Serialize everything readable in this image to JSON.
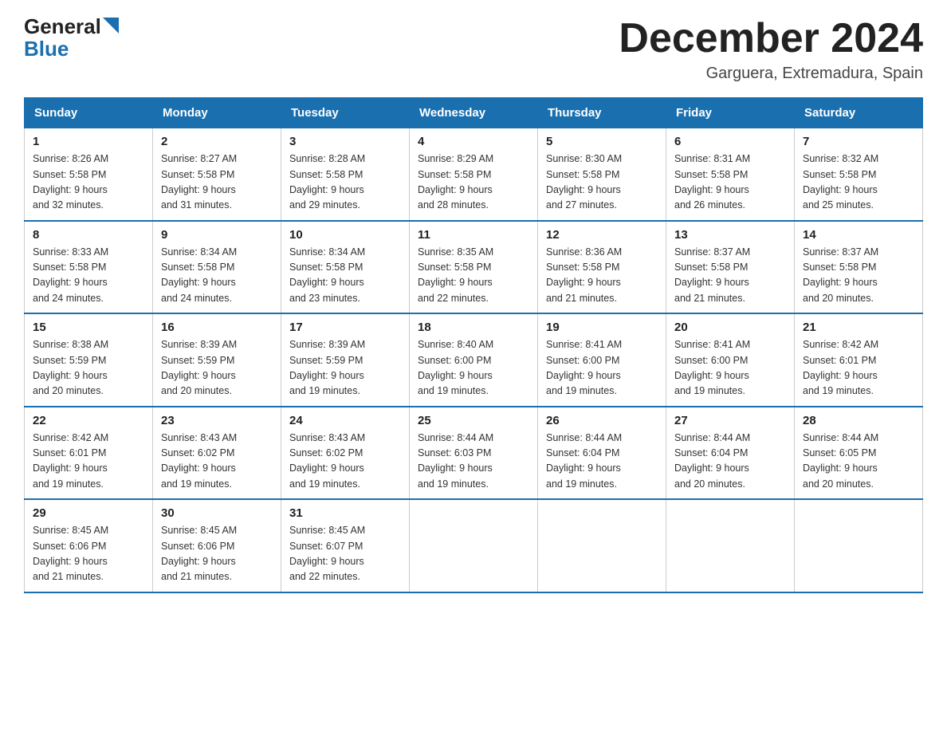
{
  "logo": {
    "general": "General",
    "arrow_color": "#1a6faf",
    "blue": "Blue"
  },
  "header": {
    "title": "December 2024",
    "subtitle": "Garguera, Extremadura, Spain"
  },
  "weekdays": [
    "Sunday",
    "Monday",
    "Tuesday",
    "Wednesday",
    "Thursday",
    "Friday",
    "Saturday"
  ],
  "weeks": [
    [
      {
        "day": "1",
        "sunrise": "8:26 AM",
        "sunset": "5:58 PM",
        "daylight": "9 hours and 32 minutes."
      },
      {
        "day": "2",
        "sunrise": "8:27 AM",
        "sunset": "5:58 PM",
        "daylight": "9 hours and 31 minutes."
      },
      {
        "day": "3",
        "sunrise": "8:28 AM",
        "sunset": "5:58 PM",
        "daylight": "9 hours and 29 minutes."
      },
      {
        "day": "4",
        "sunrise": "8:29 AM",
        "sunset": "5:58 PM",
        "daylight": "9 hours and 28 minutes."
      },
      {
        "day": "5",
        "sunrise": "8:30 AM",
        "sunset": "5:58 PM",
        "daylight": "9 hours and 27 minutes."
      },
      {
        "day": "6",
        "sunrise": "8:31 AM",
        "sunset": "5:58 PM",
        "daylight": "9 hours and 26 minutes."
      },
      {
        "day": "7",
        "sunrise": "8:32 AM",
        "sunset": "5:58 PM",
        "daylight": "9 hours and 25 minutes."
      }
    ],
    [
      {
        "day": "8",
        "sunrise": "8:33 AM",
        "sunset": "5:58 PM",
        "daylight": "9 hours and 24 minutes."
      },
      {
        "day": "9",
        "sunrise": "8:34 AM",
        "sunset": "5:58 PM",
        "daylight": "9 hours and 24 minutes."
      },
      {
        "day": "10",
        "sunrise": "8:34 AM",
        "sunset": "5:58 PM",
        "daylight": "9 hours and 23 minutes."
      },
      {
        "day": "11",
        "sunrise": "8:35 AM",
        "sunset": "5:58 PM",
        "daylight": "9 hours and 22 minutes."
      },
      {
        "day": "12",
        "sunrise": "8:36 AM",
        "sunset": "5:58 PM",
        "daylight": "9 hours and 21 minutes."
      },
      {
        "day": "13",
        "sunrise": "8:37 AM",
        "sunset": "5:58 PM",
        "daylight": "9 hours and 21 minutes."
      },
      {
        "day": "14",
        "sunrise": "8:37 AM",
        "sunset": "5:58 PM",
        "daylight": "9 hours and 20 minutes."
      }
    ],
    [
      {
        "day": "15",
        "sunrise": "8:38 AM",
        "sunset": "5:59 PM",
        "daylight": "9 hours and 20 minutes."
      },
      {
        "day": "16",
        "sunrise": "8:39 AM",
        "sunset": "5:59 PM",
        "daylight": "9 hours and 20 minutes."
      },
      {
        "day": "17",
        "sunrise": "8:39 AM",
        "sunset": "5:59 PM",
        "daylight": "9 hours and 19 minutes."
      },
      {
        "day": "18",
        "sunrise": "8:40 AM",
        "sunset": "6:00 PM",
        "daylight": "9 hours and 19 minutes."
      },
      {
        "day": "19",
        "sunrise": "8:41 AM",
        "sunset": "6:00 PM",
        "daylight": "9 hours and 19 minutes."
      },
      {
        "day": "20",
        "sunrise": "8:41 AM",
        "sunset": "6:00 PM",
        "daylight": "9 hours and 19 minutes."
      },
      {
        "day": "21",
        "sunrise": "8:42 AM",
        "sunset": "6:01 PM",
        "daylight": "9 hours and 19 minutes."
      }
    ],
    [
      {
        "day": "22",
        "sunrise": "8:42 AM",
        "sunset": "6:01 PM",
        "daylight": "9 hours and 19 minutes."
      },
      {
        "day": "23",
        "sunrise": "8:43 AM",
        "sunset": "6:02 PM",
        "daylight": "9 hours and 19 minutes."
      },
      {
        "day": "24",
        "sunrise": "8:43 AM",
        "sunset": "6:02 PM",
        "daylight": "9 hours and 19 minutes."
      },
      {
        "day": "25",
        "sunrise": "8:44 AM",
        "sunset": "6:03 PM",
        "daylight": "9 hours and 19 minutes."
      },
      {
        "day": "26",
        "sunrise": "8:44 AM",
        "sunset": "6:04 PM",
        "daylight": "9 hours and 19 minutes."
      },
      {
        "day": "27",
        "sunrise": "8:44 AM",
        "sunset": "6:04 PM",
        "daylight": "9 hours and 20 minutes."
      },
      {
        "day": "28",
        "sunrise": "8:44 AM",
        "sunset": "6:05 PM",
        "daylight": "9 hours and 20 minutes."
      }
    ],
    [
      {
        "day": "29",
        "sunrise": "8:45 AM",
        "sunset": "6:06 PM",
        "daylight": "9 hours and 21 minutes."
      },
      {
        "day": "30",
        "sunrise": "8:45 AM",
        "sunset": "6:06 PM",
        "daylight": "9 hours and 21 minutes."
      },
      {
        "day": "31",
        "sunrise": "8:45 AM",
        "sunset": "6:07 PM",
        "daylight": "9 hours and 22 minutes."
      },
      null,
      null,
      null,
      null
    ]
  ],
  "labels": {
    "sunrise": "Sunrise:",
    "sunset": "Sunset:",
    "daylight": "Daylight:"
  }
}
